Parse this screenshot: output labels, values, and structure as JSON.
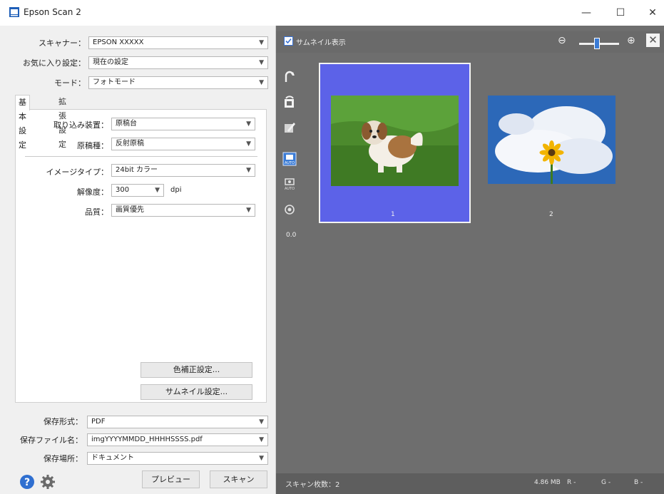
{
  "window": {
    "title": "Epson Scan 2",
    "minimize_glyph": "—",
    "maximize_glyph": "☐",
    "close_glyph": "✕"
  },
  "settings": {
    "scanner_label": "スキャナー：",
    "scanner_value": "EPSON XXXXX",
    "favorites_label": "お気に入り設定：",
    "favorites_value": "現在の設定",
    "mode_label": "モード：",
    "mode_value": "フォトモード"
  },
  "tabs": {
    "basic": "基本設定",
    "advanced": "拡張設定"
  },
  "basic": {
    "source_label": "取り込み装置：",
    "source_value": "原稿台",
    "doc_type_label": "原稿種：",
    "doc_type_value": "反射原稿",
    "image_type_label": "イメージタイプ：",
    "image_type_value": "24bit カラー",
    "resolution_label": "解像度：",
    "resolution_value": "300",
    "resolution_unit": "dpi",
    "quality_label": "品質：",
    "quality_value": "画質優先",
    "color_correction_button": "色補正設定...",
    "thumbnail_settings_button": "サムネイル設定..."
  },
  "save": {
    "format_label": "保存形式：",
    "format_value": "PDF",
    "filename_label": "保存ファイル名：",
    "filename_value": "imgYYYYMMDD_HHHHSSSS.pdf",
    "location_label": "保存場所：",
    "location_value": "ドキュメント"
  },
  "footer": {
    "preview_button": "プレビュー",
    "scan_button": "スキャン"
  },
  "preview": {
    "thumbnail_toggle_label": "サムネイル表示",
    "zoom_percent_of_track": 45,
    "rotation_value": "0.0",
    "thumbnails": [
      {
        "number": "1",
        "selected": true
      },
      {
        "number": "2",
        "selected": false
      }
    ]
  },
  "status": {
    "scan_count": "スキャン枚数：2",
    "file_size": "4.86 MB",
    "r_label": "R  -",
    "g_label": "G  -",
    "b_label": "B  -"
  },
  "colors": {
    "selected_thumbnail": "#5c62e8",
    "preview_background": "#6e6e6e",
    "accent": "#3a7bd5"
  }
}
